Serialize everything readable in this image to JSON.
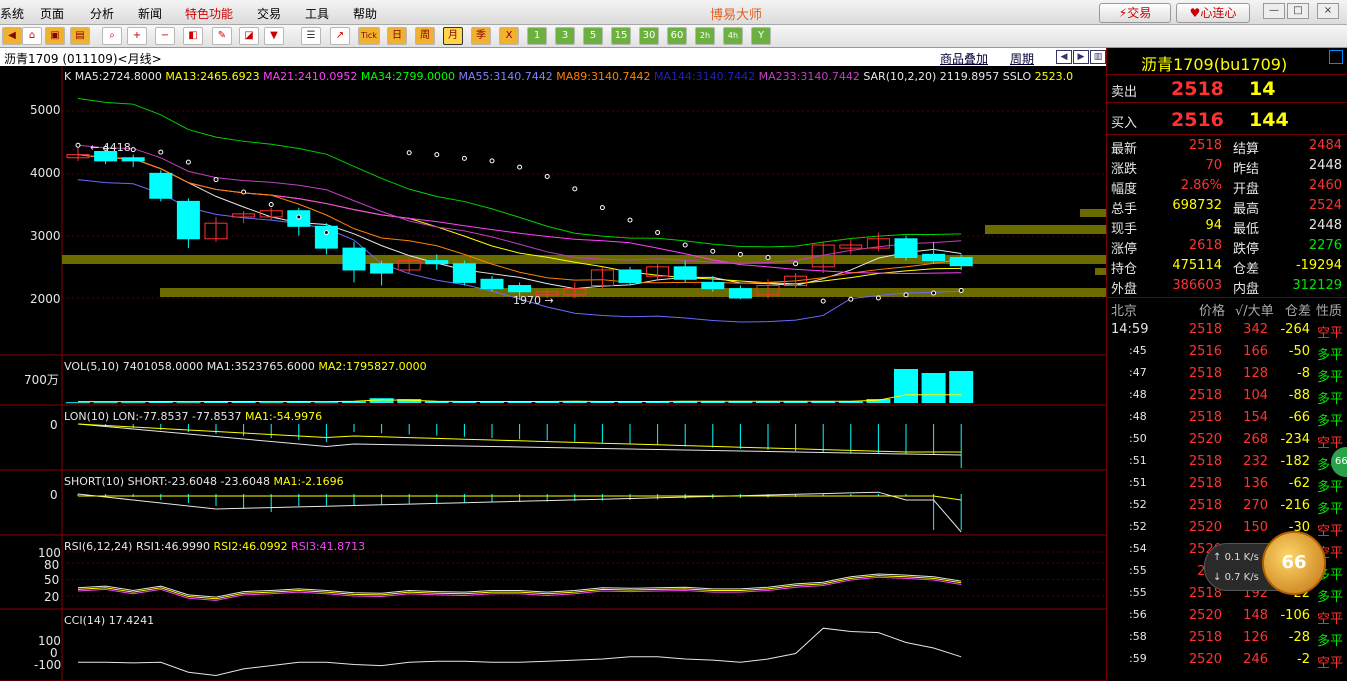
{
  "menu": {
    "items": [
      "系统",
      "页面",
      "分析",
      "新闻",
      "特色功能",
      "交易",
      "工具",
      "帮助"
    ],
    "app_title": "博易大师",
    "trade_button": "交易",
    "connect_button": "心连心",
    "window_buttons": [
      "—",
      "□",
      "×"
    ]
  },
  "toolbar": {
    "period_buttons": [
      "Tick",
      "日",
      "周",
      "月",
      "季",
      "X",
      "1",
      "3",
      "5",
      "15",
      "30",
      "60",
      "2h",
      "4h",
      "Y"
    ],
    "selected_period": "月"
  },
  "chart_header": {
    "symbol": "沥青1709 (011109)",
    "period": "<月线>",
    "overlay_link": "商品叠加",
    "period_link": "周期"
  },
  "ma_legend": {
    "prefix": "K",
    "items": [
      {
        "text": "MA5:2724.8000",
        "color": "#e6e6e6"
      },
      {
        "text": "MA13:2465.6923",
        "color": "#ffff00"
      },
      {
        "text": "MA21:2410.0952",
        "color": "#ff40ff"
      },
      {
        "text": "MA34:2799.0000",
        "color": "#00ff00"
      },
      {
        "text": "MA55:3140.7442",
        "color": "#8080ff"
      },
      {
        "text": "MA89:3140.7442",
        "color": "#ff8000"
      },
      {
        "text": "MA144:3140.7442",
        "color": "#2020c0"
      },
      {
        "text": "MA233:3140.7442",
        "color": "#c040c0"
      },
      {
        "text": "SAR(10,2,20)",
        "color": "#e6e6e6"
      },
      {
        "text": "2119.8957",
        "color": "#e6e6e6"
      },
      {
        "text": "SSLO",
        "color": "#e6e6e6"
      },
      {
        "text": "2523.0",
        "color": "#ffff00"
      }
    ]
  },
  "axes": {
    "price_ticks": [
      "5000",
      "4000",
      "3000",
      "2000"
    ],
    "vol_tick": "700万",
    "lon_tick": "0",
    "short_tick": "0",
    "rsi_ticks": [
      "100",
      "80",
      "50",
      "20"
    ],
    "cci_ticks": [
      "100",
      "0",
      "-100"
    ]
  },
  "annotations": {
    "high": "4418",
    "low": "1970"
  },
  "panels": {
    "vol": {
      "label": "VOL(5,10)",
      "value": "7401058.0000",
      "ma1": "MA1:3523765.6000",
      "ma2": "MA2:1795827.0000"
    },
    "lon": {
      "label": "LON(10)",
      "value": "LON:-77.8537",
      "v2": "-77.8537",
      "ma1": "MA1:-54.9976"
    },
    "short": {
      "label": "SHORT(10)",
      "value": "SHORT:-23.6048",
      "v2": "-23.6048",
      "ma1": "MA1:-2.1696"
    },
    "rsi": {
      "label": "RSI(6,12,24)",
      "r1": "RSI1:46.9990",
      "r2": "RSI2:46.0992",
      "r3": "RSI3:41.8713"
    },
    "cci": {
      "label": "CCI(14)",
      "value": "17.4241"
    }
  },
  "chart_data": {
    "type": "candlestick",
    "period": "monthly",
    "ylim": [
      1500,
      5500
    ],
    "candles": [
      {
        "o": 4250,
        "c": 4300,
        "h": 4418,
        "l": 4200
      },
      {
        "o": 4350,
        "c": 4200,
        "h": 4400,
        "l": 4150
      },
      {
        "o": 4250,
        "c": 4200,
        "h": 4300,
        "l": 4100
      },
      {
        "o": 4000,
        "c": 3600,
        "h": 4050,
        "l": 3550
      },
      {
        "o": 3550,
        "c": 2950,
        "h": 3600,
        "l": 2800
      },
      {
        "o": 2950,
        "c": 3200,
        "h": 3300,
        "l": 2900
      },
      {
        "o": 3300,
        "c": 3350,
        "h": 3400,
        "l": 3200
      },
      {
        "o": 3300,
        "c": 3400,
        "h": 3450,
        "l": 3250
      },
      {
        "o": 3400,
        "c": 3150,
        "h": 3450,
        "l": 3000
      },
      {
        "o": 3150,
        "c": 2800,
        "h": 3200,
        "l": 2700
      },
      {
        "o": 2800,
        "c": 2450,
        "h": 2900,
        "l": 2250
      },
      {
        "o": 2550,
        "c": 2400,
        "h": 2600,
        "l": 2200
      },
      {
        "o": 2450,
        "c": 2600,
        "h": 2650,
        "l": 2400
      },
      {
        "o": 2600,
        "c": 2550,
        "h": 2700,
        "l": 2450
      },
      {
        "o": 2550,
        "c": 2250,
        "h": 2600,
        "l": 2200
      },
      {
        "o": 2300,
        "c": 2150,
        "h": 2350,
        "l": 2100
      },
      {
        "o": 2200,
        "c": 2100,
        "h": 2250,
        "l": 1970
      },
      {
        "o": 2050,
        "c": 2100,
        "h": 2150,
        "l": 2000
      },
      {
        "o": 2050,
        "c": 2150,
        "h": 2250,
        "l": 2000
      },
      {
        "o": 2200,
        "c": 2450,
        "h": 2500,
        "l": 2150
      },
      {
        "o": 2450,
        "c": 2250,
        "h": 2500,
        "l": 2200
      },
      {
        "o": 2350,
        "c": 2500,
        "h": 2550,
        "l": 2300
      },
      {
        "o": 2500,
        "c": 2300,
        "h": 2600,
        "l": 2250
      },
      {
        "o": 2250,
        "c": 2150,
        "h": 2350,
        "l": 2100
      },
      {
        "o": 2150,
        "c": 2000,
        "h": 2200,
        "l": 1980
      },
      {
        "o": 2050,
        "c": 2200,
        "h": 2300,
        "l": 2000
      },
      {
        "o": 2200,
        "c": 2350,
        "h": 2400,
        "l": 2150
      },
      {
        "o": 2500,
        "c": 2850,
        "h": 2900,
        "l": 2400
      },
      {
        "o": 2800,
        "c": 2850,
        "h": 2950,
        "l": 2700
      },
      {
        "o": 2800,
        "c": 2950,
        "h": 3050,
        "l": 2750
      },
      {
        "o": 2950,
        "c": 2650,
        "h": 3000,
        "l": 2600
      },
      {
        "o": 2700,
        "c": 2600,
        "h": 2900,
        "l": 2550
      },
      {
        "o": 2650,
        "c": 2518,
        "h": 2700,
        "l": 2448
      }
    ],
    "sar": [
      4450,
      4400,
      4380,
      4340,
      4180,
      3900,
      3700,
      3500,
      3300,
      3050,
      null,
      null,
      4330,
      4300,
      4240,
      4200,
      4100,
      3950,
      3750,
      3450,
      3250,
      3050,
      2850,
      2750,
      2700,
      2650,
      2550,
      1950,
      1980,
      2000,
      2050,
      2080,
      2120
    ],
    "volume_rel": [
      0.02,
      0.02,
      0.02,
      0.03,
      0.02,
      0.03,
      0.03,
      0.02,
      0.03,
      0.02,
      0.04,
      0.12,
      0.1,
      0.04,
      0.03,
      0.03,
      0.03,
      0.03,
      0.04,
      0.03,
      0.03,
      0.03,
      0.04,
      0.04,
      0.04,
      0.04,
      0.04,
      0.04,
      0.04,
      0.1,
      0.85,
      0.75,
      0.8
    ]
  },
  "quote": {
    "title": "沥青1709(bu1709)",
    "sell": {
      "label": "卖出",
      "price": "2518",
      "vol": "14"
    },
    "buy": {
      "label": "买入",
      "price": "2516",
      "vol": "144"
    },
    "fields": [
      {
        "l1": "最新",
        "v1": "2518",
        "c1": "red",
        "l2": "结算",
        "v2": "2484",
        "c2": "red"
      },
      {
        "l1": "涨跌",
        "v1": "70",
        "c1": "red",
        "l2": "昨结",
        "v2": "2448",
        "c2": "wht"
      },
      {
        "l1": "幅度",
        "v1": "2.86%",
        "c1": "red",
        "l2": "开盘",
        "v2": "2460",
        "c2": "red"
      },
      {
        "l1": "总手",
        "v1": "698732",
        "c1": "yel",
        "l2": "最高",
        "v2": "2524",
        "c2": "red"
      },
      {
        "l1": "现手",
        "v1": "94",
        "c1": "yel",
        "l2": "最低",
        "v2": "2448",
        "c2": "wht"
      },
      {
        "l1": "涨停",
        "v1": "2618",
        "c1": "red",
        "l2": "跌停",
        "v2": "2276",
        "c2": "grn"
      },
      {
        "l1": "持仓",
        "v1": "475114",
        "c1": "yel",
        "l2": "仓差",
        "v2": "-19294",
        "c2": "yel"
      },
      {
        "l1": "外盘",
        "v1": "386603",
        "c1": "red",
        "l2": "内盘",
        "v2": "312129",
        "c2": "grn"
      }
    ],
    "tick_header": {
      "time": "北京",
      "price": "价格",
      "vol": "√/大单",
      "diff": "仓差",
      "nature": "性质"
    },
    "ticks": [
      {
        "t": "14:59",
        "p": "2518",
        "v": "342",
        "d": "-264",
        "n": "空平",
        "nc": "red"
      },
      {
        "t": ":45",
        "p": "2516",
        "v": "166",
        "d": "-50",
        "n": "多平",
        "nc": "grn"
      },
      {
        "t": ":47",
        "p": "2518",
        "v": "128",
        "d": "-8",
        "n": "多平",
        "nc": "grn"
      },
      {
        "t": ":48",
        "p": "2518",
        "v": "104",
        "d": "-88",
        "n": "多平",
        "nc": "grn"
      },
      {
        "t": ":48",
        "p": "2518",
        "v": "154",
        "d": "-66",
        "n": "多平",
        "nc": "grn"
      },
      {
        "t": ":50",
        "p": "2520",
        "v": "268",
        "d": "-234",
        "n": "空平",
        "nc": "red"
      },
      {
        "t": ":51",
        "p": "2518",
        "v": "232",
        "d": "-182",
        "n": "多平",
        "nc": "grn"
      },
      {
        "t": ":51",
        "p": "2518",
        "v": "136",
        "d": "-62",
        "n": "多平",
        "nc": "grn"
      },
      {
        "t": ":52",
        "p": "2518",
        "v": "270",
        "d": "-216",
        "n": "多平",
        "nc": "grn"
      },
      {
        "t": ":52",
        "p": "2520",
        "v": "150",
        "d": "-30",
        "n": "空平",
        "nc": "red"
      },
      {
        "t": ":54",
        "p": "2520",
        "v": "",
        "d": "",
        "n": "空平",
        "nc": "red"
      },
      {
        "t": ":55",
        "p": "251",
        "v": "",
        "d": "",
        "n": "多平",
        "nc": "grn"
      },
      {
        "t": ":55",
        "p": "2518",
        "v": "192",
        "d": "-22",
        "n": "多平",
        "nc": "grn"
      },
      {
        "t": ":56",
        "p": "2520",
        "v": "148",
        "d": "-106",
        "n": "空平",
        "nc": "red"
      },
      {
        "t": ":58",
        "p": "2518",
        "v": "126",
        "d": "-28",
        "n": "多平",
        "nc": "grn"
      },
      {
        "t": ":59",
        "p": "2520",
        "v": "246",
        "d": "-2",
        "n": "空平",
        "nc": "red"
      }
    ]
  },
  "widget": {
    "up": "0.1",
    "down": "0.7",
    "unit": "K/s",
    "score": "66",
    "edge_badge": "66"
  }
}
